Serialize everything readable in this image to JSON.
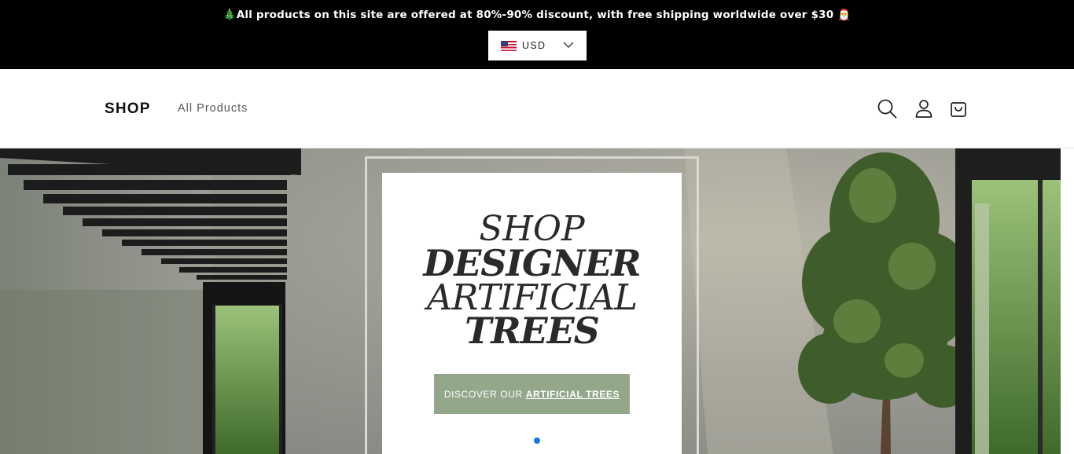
{
  "announcement": {
    "text": "🎄All products on this site are offered at 80%-90% discount, with free shipping worldwide over $30 🎅"
  },
  "currency": {
    "selected": "USD",
    "flag_icon": "us-flag-icon"
  },
  "header": {
    "brand": "SHOP",
    "nav": [
      {
        "label": "All Products"
      }
    ],
    "icons": [
      "search-icon",
      "account-icon",
      "cart-icon"
    ]
  },
  "hero": {
    "headline": [
      "SHOP",
      "DESIGNER",
      "ARTIFICIAL",
      "TREES"
    ],
    "cta": {
      "prefix": "DISCOVER OUR",
      "emphasis": "ARTIFICIAL TREES"
    },
    "slides": {
      "current": 1,
      "total": 1
    },
    "colors": {
      "cta_background": "#93a88b",
      "active_dot": "#1a73e8"
    }
  }
}
